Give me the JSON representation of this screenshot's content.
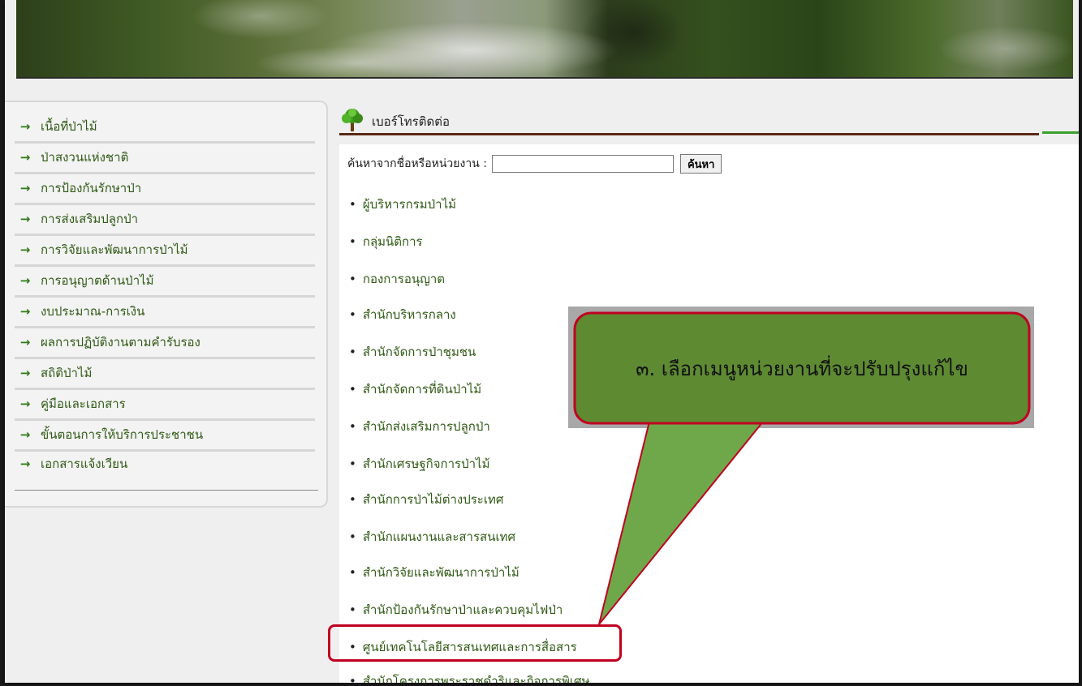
{
  "header": {
    "title": "เบอร์โทรติดต่อ"
  },
  "search": {
    "label": "ค้นหาจากชื่อหรือหน่วยงาน :",
    "value": "",
    "button_label": "ค้นหา"
  },
  "sidebar": {
    "items": [
      {
        "label": "เนื้อที่ป่าไม้"
      },
      {
        "label": "ป่าสงวนแห่งชาติ"
      },
      {
        "label": "การป้องกันรักษาป่า"
      },
      {
        "label": "การส่งเสริมปลูกป่า"
      },
      {
        "label": "การวิจัยและพัฒนาการป่าไม้"
      },
      {
        "label": "การอนุญาตด้านป่าไม้"
      },
      {
        "label": "งบประมาณ-การเงิน"
      },
      {
        "label": "ผลการปฏิบัติงานตามคำรับรอง"
      },
      {
        "label": "สถิติป่าไม้"
      },
      {
        "label": "คู่มือและเอกสาร"
      },
      {
        "label": "ขั้นตอนการให้บริการประชาชน"
      },
      {
        "label": "เอกสารแจ้งเวียน"
      }
    ]
  },
  "units": [
    {
      "label": "ผู้บริหารกรมป่าไม้"
    },
    {
      "label": "กลุ่มนิติการ"
    },
    {
      "label": "กองการอนุญาต"
    },
    {
      "label": "สำนักบริหารกลาง"
    },
    {
      "label": "สำนักจัดการป่าชุมชน"
    },
    {
      "label": "สำนักจัดการที่ดินป่าไม้"
    },
    {
      "label": "สำนักส่งเสริมการปลูกป่า"
    },
    {
      "label": "สำนักเศรษฐกิจการป่าไม้"
    },
    {
      "label": "สำนักการป่าไม้ต่างประเทศ"
    },
    {
      "label": "สำนักแผนงานและสารสนเทศ"
    },
    {
      "label": "สำนักวิจัยและพัฒนาการป่าไม้"
    },
    {
      "label": "สำนักป้องกันรักษาป่าและควบคุมไฟป่า"
    },
    {
      "label": "ศูนย์เทคโนโลยีสารสนเทศและการสื่อสาร"
    },
    {
      "label": "สำนักโครงการพระราชดำริและกิจการพิเศษ"
    }
  ],
  "callout": {
    "text": "๓. เลือกเมนูหน่วยงานที่จะปรับปรุงแก้ไข"
  },
  "icons": {
    "sidebar_arrow": "→",
    "bullet": "•"
  },
  "colors": {
    "link_green": "#2f5a14",
    "callout_fill": "#5e8a32",
    "callout_border": "#c00020",
    "highlight_border": "#c00020"
  }
}
